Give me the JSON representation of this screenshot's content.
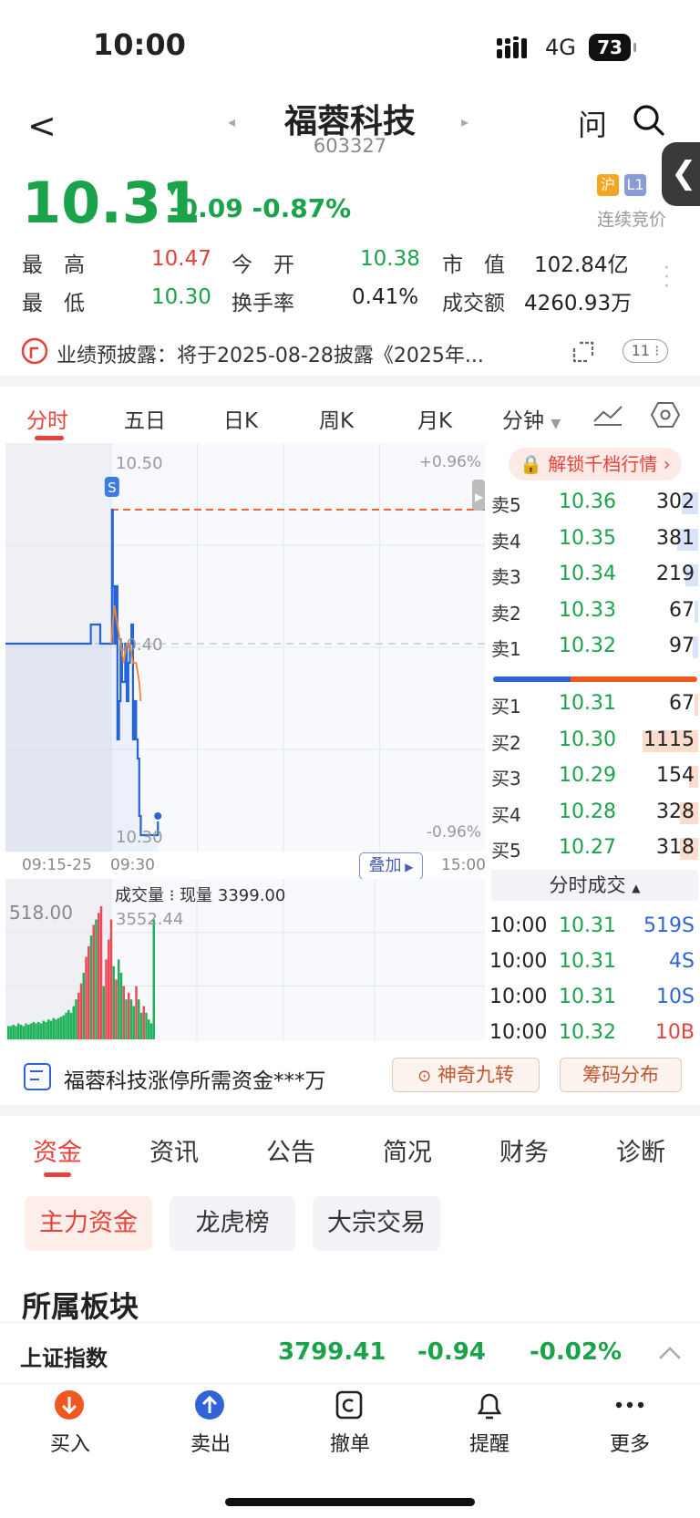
{
  "status": {
    "time": "10:00",
    "network": "4G",
    "battery": "73"
  },
  "nav": {
    "back": "<",
    "title": "福蓉科技",
    "code": "603327",
    "ask": "问",
    "prev_arrow": "◂",
    "next_arrow": "▸"
  },
  "quote": {
    "price": "10.31",
    "change": "-0.09",
    "change_pct": "-0.87%",
    "market_tag": "沪",
    "level_tag": "L1",
    "trade_mode": "连续竞价",
    "stats": [
      {
        "label": "最　高",
        "value": "10.47",
        "color": "red"
      },
      {
        "label": "今　开",
        "value": "10.38",
        "color": "green"
      },
      {
        "label": "市　值",
        "value": "102.84亿",
        "color": "black"
      },
      {
        "label": "最　低",
        "value": "10.30",
        "color": "green"
      },
      {
        "label": "换手率",
        "value": "0.41%",
        "color": "black"
      },
      {
        "label": "成交额",
        "value": "4260.93万",
        "color": "black"
      }
    ]
  },
  "notice": {
    "text": "业绩预披露：将于2025-08-28披露《2025年...",
    "badge": "11"
  },
  "chart_tabs": [
    "分时",
    "五日",
    "日K",
    "周K",
    "月K",
    "分钟"
  ],
  "chart_data": {
    "type": "line",
    "title": "",
    "y_ticks_left": [
      "10.50",
      "10.40",
      "10.30"
    ],
    "y_ticks_right": [
      "+0.96%",
      "-0.96%"
    ],
    "x_ticks": [
      "09:15-25",
      "09:30",
      "15:00"
    ],
    "overlay_button": "叠加",
    "badge": "S",
    "volume_label": "成交量",
    "volume_current": "现量 3399.00",
    "volume_left_tick": "518.00",
    "volume_max": "3552.44",
    "series": [
      {
        "name": "price",
        "color": "#2563d8",
        "x": [
          "09:15",
          "09:18",
          "09:21",
          "09:24",
          "09:25",
          "09:30",
          "09:30.5",
          "09:31",
          "09:32",
          "09:33",
          "09:34",
          "09:35",
          "09:36",
          "09:37",
          "09:38",
          "09:39",
          "09:40",
          "09:41",
          "09:42",
          "09:43",
          "09:44",
          "09:45",
          "09:46",
          "09:47",
          "09:48",
          "09:49",
          "10:00"
        ],
        "y": [
          10.4,
          10.4,
          10.4,
          10.41,
          10.4,
          10.4,
          10.47,
          10.43,
          10.4,
          10.43,
          10.35,
          10.37,
          10.4,
          10.38,
          10.38,
          10.4,
          10.37,
          10.39,
          10.4,
          10.41,
          10.35,
          10.37,
          10.35,
          10.34,
          10.31,
          10.3,
          10.31
        ]
      },
      {
        "name": "average",
        "color": "#f0862e",
        "x": [
          "09:30",
          "09:32",
          "09:34",
          "09:36",
          "09:38",
          "09:40",
          "09:42",
          "09:44",
          "09:46",
          "09:48",
          "09:49"
        ],
        "y": [
          10.4,
          10.42,
          10.41,
          10.4,
          10.39,
          10.4,
          10.4,
          10.39,
          10.39,
          10.38,
          10.37
        ]
      }
    ],
    "ref_price": 10.4,
    "high_line": 10.47
  },
  "order_book": {
    "lock_label": "解锁千档行情",
    "asks": [
      {
        "label": "卖5",
        "price": "10.36",
        "volume": "302",
        "bar": 0.27
      },
      {
        "label": "卖4",
        "price": "10.35",
        "volume": "381",
        "bar": 0.34
      },
      {
        "label": "卖3",
        "price": "10.34",
        "volume": "219",
        "bar": 0.2
      },
      {
        "label": "卖2",
        "price": "10.33",
        "volume": "67",
        "bar": 0.06
      },
      {
        "label": "卖1",
        "price": "10.32",
        "volume": "97",
        "bar": 0.09
      }
    ],
    "bids": [
      {
        "label": "买1",
        "price": "10.31",
        "volume": "67",
        "bar": 0.06
      },
      {
        "label": "买2",
        "price": "10.30",
        "volume": "1115",
        "bar": 0.9
      },
      {
        "label": "买3",
        "price": "10.29",
        "volume": "154",
        "bar": 0.14
      },
      {
        "label": "买4",
        "price": "10.28",
        "volume": "328",
        "bar": 0.3
      },
      {
        "label": "买5",
        "price": "10.27",
        "volume": "318",
        "bar": 0.29
      }
    ],
    "balance_buy": 0.38,
    "tick_header": "分时成交",
    "ticks": [
      {
        "time": "10:00",
        "price": "10.31",
        "volume": "519S",
        "color": "blue"
      },
      {
        "time": "10:00",
        "price": "10.31",
        "volume": "4S",
        "color": "blue"
      },
      {
        "time": "10:00",
        "price": "10.31",
        "volume": "10S",
        "color": "blue"
      },
      {
        "time": "10:00",
        "price": "10.32",
        "volume": "10B",
        "color": "red"
      }
    ]
  },
  "tools": {
    "limitup_text": "福蓉科技涨停所需资金***万",
    "nine": "神奇九转",
    "chips": "筹码分布"
  },
  "bottom_tabs": [
    "资金",
    "资讯",
    "公告",
    "简况",
    "财务",
    "诊断"
  ],
  "pills": [
    "主力资金",
    "龙虎榜",
    "大宗交易"
  ],
  "sector": {
    "title": "所属板块",
    "index_name": "上证指数",
    "index_value": "3799.41",
    "index_change": "-0.94",
    "index_pct": "-0.02%"
  },
  "bottom_nav": [
    "买入",
    "卖出",
    "撤单",
    "提醒",
    "更多"
  ]
}
